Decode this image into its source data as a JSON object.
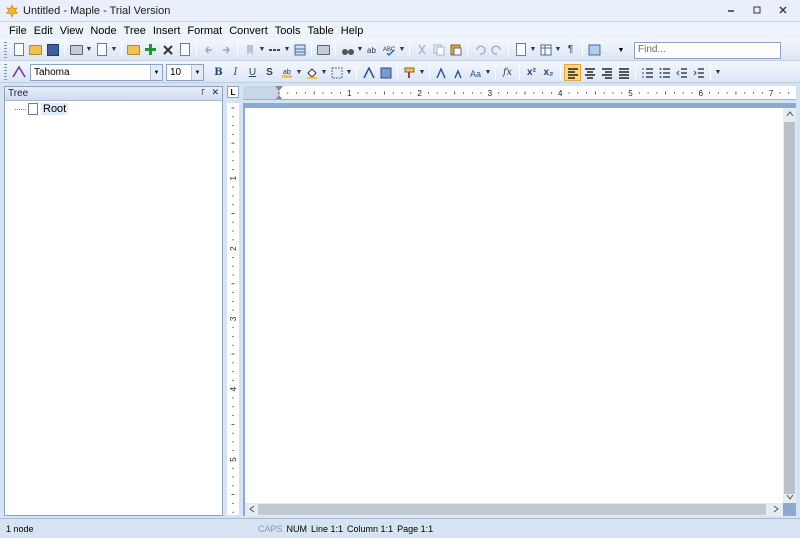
{
  "window": {
    "title": "Untitled - Maple - Trial Version",
    "minimize": "▭",
    "maximize": "◫",
    "close": "✕"
  },
  "menu": [
    "File",
    "Edit",
    "View",
    "Node",
    "Tree",
    "Insert",
    "Format",
    "Convert",
    "Tools",
    "Table",
    "Help"
  ],
  "toolbar": {
    "find_placeholder": "Find...",
    "font": "Tahoma",
    "font_size": "10",
    "bold": "B",
    "italic": "I",
    "underline": "U",
    "strike": "S",
    "fx": "fx",
    "superscript": "x²",
    "subscript": "x₂",
    "pilcrow": "¶"
  },
  "tree_panel": {
    "title": "Tree",
    "pin": "꜒",
    "close": "✕",
    "root_label": "Root"
  },
  "ruler": {
    "horizontal_labels": [
      "1",
      "2",
      "3",
      "4",
      "5",
      "6",
      "7"
    ],
    "vertical_labels": [
      "1",
      "2",
      "3",
      "4",
      "5"
    ],
    "corner": "L"
  },
  "status": {
    "node_count": "1 node",
    "caps": "CAPS",
    "num": "NUM",
    "line": "Line 1:1",
    "column": "Column 1:1",
    "page": "Page 1:1"
  }
}
